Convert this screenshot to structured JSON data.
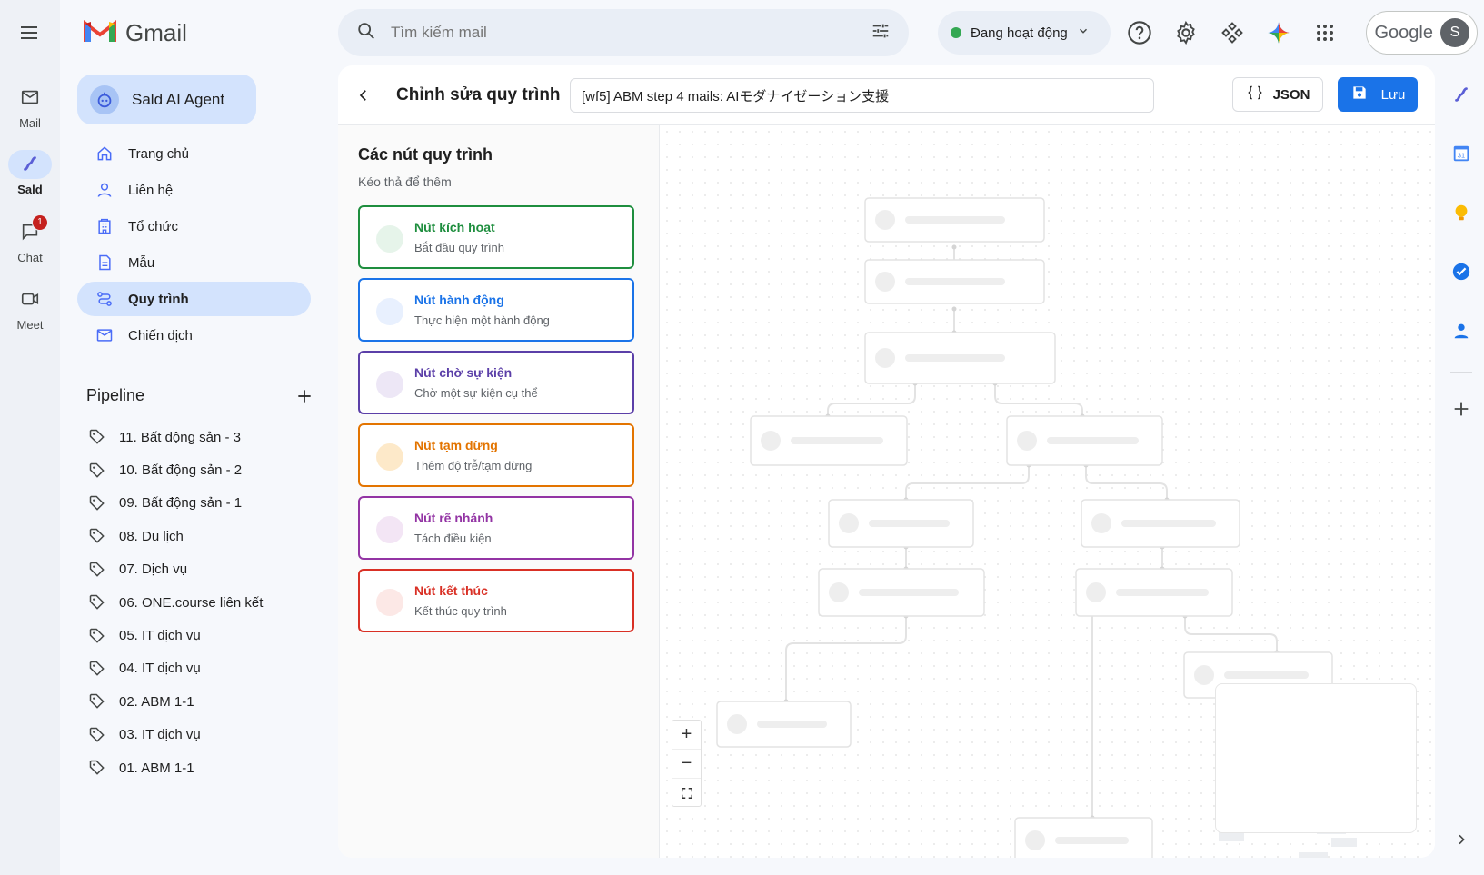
{
  "rail": {
    "items": [
      {
        "label": "Mail",
        "icon": "mail-icon"
      },
      {
        "label": "Sald",
        "icon": "sald-icon"
      },
      {
        "label": "Chat",
        "icon": "chat-icon",
        "badge": "1"
      },
      {
        "label": "Meet",
        "icon": "meet-icon"
      }
    ]
  },
  "app": {
    "name": "Gmail"
  },
  "sidebar": {
    "agent_label": "Sald AI Agent",
    "nav": [
      {
        "label": "Trang chủ",
        "icon": "home-icon"
      },
      {
        "label": "Liên hệ",
        "icon": "person-icon"
      },
      {
        "label": "Tổ chức",
        "icon": "building-icon"
      },
      {
        "label": "Mẫu",
        "icon": "document-icon"
      },
      {
        "label": "Quy trình",
        "icon": "workflow-icon"
      },
      {
        "label": "Chiến dịch",
        "icon": "mail-icon"
      }
    ],
    "pipeline_title": "Pipeline",
    "pipeline": [
      "11. Bất động sản - 3",
      "10. Bất động sản - 2",
      "09. Bất động sản - 1",
      "08. Du lịch",
      "07. Dịch vụ",
      "06. ONE.course liên kết",
      "05. IT dịch vụ",
      "04. IT dịch vụ",
      "02. ABM 1-1",
      "03. IT dịch vụ",
      "01. ABM 1-1"
    ]
  },
  "topbar": {
    "search_placeholder": "Tìm kiếm mail",
    "status": "Đang hoạt động",
    "account_brand": "Google",
    "avatar_initial": "S"
  },
  "editor": {
    "title": "Chỉnh sửa quy trình",
    "workflow_name": "[wf5] ABM step 4 mails: AIモダナイゼーション支援",
    "json_label": "JSON",
    "save_label": "Lưu"
  },
  "palette": {
    "title": "Các nút quy trình",
    "subtitle": "Kéo thả để thêm",
    "nodes": [
      {
        "title": "Nút kích hoạt",
        "desc": "Bắt đầu quy trình",
        "color": "#1e8e3e",
        "dot": "#e6f4ea"
      },
      {
        "title": "Nút hành động",
        "desc": "Thực hiện một hành động",
        "color": "#1a73e8",
        "dot": "#e8f0fe"
      },
      {
        "title": "Nút chờ sự kiện",
        "desc": "Chờ một sự kiện cụ thể",
        "color": "#5b3fa8",
        "dot": "#ede7f6"
      },
      {
        "title": "Nút tạm dừng",
        "desc": "Thêm độ trễ/tạm dừng",
        "color": "#e37400",
        "dot": "#fde9c9"
      },
      {
        "title": "Nút rẽ nhánh",
        "desc": "Tách điều kiện",
        "color": "#9334a4",
        "dot": "#f3e5f5"
      },
      {
        "title": "Nút kết thúc",
        "desc": "Kết thúc quy trình",
        "color": "#d93025",
        "dot": "#fce8e6"
      }
    ]
  },
  "colors": {
    "accent": "#1a73e8",
    "active_nav": "#d3e3fd",
    "status_green": "#34a853"
  }
}
